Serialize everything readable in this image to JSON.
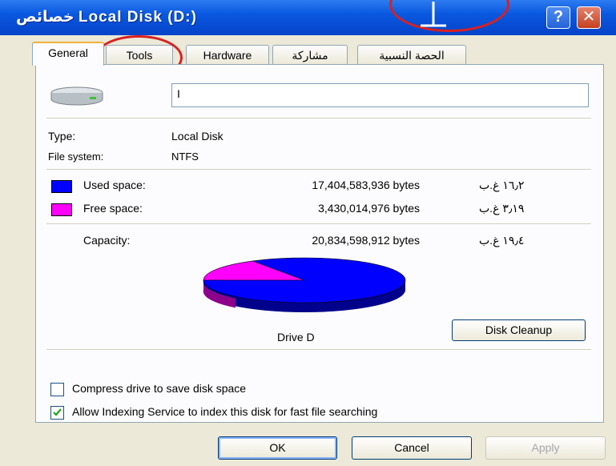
{
  "window": {
    "title_prefix": "خصائص",
    "title": "Local Disk (D:)",
    "help_icon": "?",
    "close_icon": "✕"
  },
  "tabs": [
    {
      "label": "General",
      "active": true
    },
    {
      "label": "Tools",
      "active": false
    },
    {
      "label": "Hardware",
      "active": false
    },
    {
      "label": "مشاركة",
      "active": false
    },
    {
      "label": "الحصة النسبية",
      "active": false
    }
  ],
  "drive": {
    "name_value": "I",
    "type_label": "Type:",
    "type_value": "Local Disk",
    "fs_label": "File system:",
    "fs_value": "NTFS"
  },
  "space": {
    "used": {
      "label": "Used space:",
      "bytes": "17,404,583,936 bytes",
      "size": "١٦٫٢ غ.ب",
      "color": "#0000ff"
    },
    "free": {
      "label": "Free space:",
      "bytes": "3,430,014,976 bytes",
      "size": "٣٫١٩ غ.ب",
      "color": "#ff00ff"
    },
    "capacity": {
      "label": "Capacity:",
      "bytes": "20,834,598,912 bytes",
      "size": "١٩٫٤ غ.ب"
    }
  },
  "chart_data": {
    "type": "pie",
    "categories": [
      "Used space",
      "Free space"
    ],
    "values": [
      17404583936,
      3430014976
    ],
    "colors": [
      "#0000ff",
      "#ff00ff"
    ]
  },
  "drive_label": "Drive D",
  "cleanup_label": "Disk Cleanup",
  "options": {
    "compress": {
      "label": "Compress drive to save disk space",
      "checked": false
    },
    "index": {
      "label": "Allow Indexing Service to index this disk for fast file searching",
      "checked": true
    }
  },
  "buttons": {
    "ok": "OK",
    "cancel": "Cancel",
    "apply": "Apply"
  },
  "icons": {
    "drive": "hard-drive-icon",
    "cursor": "text-cursor-icon"
  },
  "annotation_color": "#d92020"
}
